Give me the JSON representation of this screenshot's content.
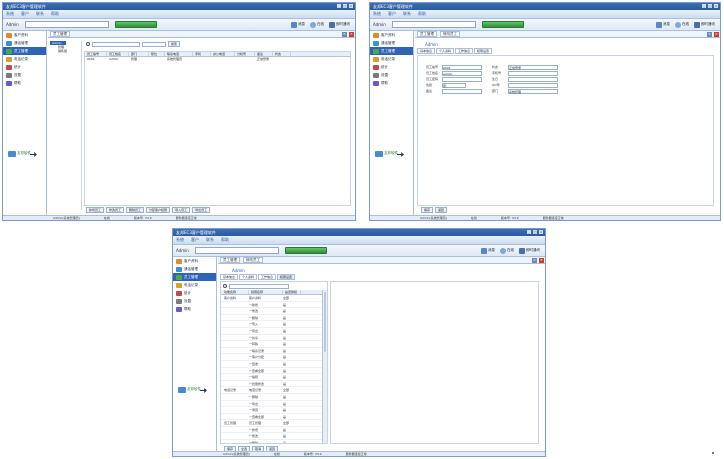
{
  "app": {
    "title": "友邦EC3客户管理软件",
    "menus": [
      "系统",
      "客户",
      "联系",
      "帮助"
    ],
    "user": "Admin",
    "toolbar_buttons": [
      "消息",
      "在线",
      "即时通讯"
    ]
  },
  "sidebar": {
    "items": [
      {
        "label": "客户资料",
        "icon": "customer-icon",
        "color": "#e08a2a"
      },
      {
        "label": "通话管理",
        "icon": "phone-icon",
        "color": "#3c8fd6"
      },
      {
        "label": "员工管理",
        "icon": "staff-icon",
        "color": "#4aa84e"
      },
      {
        "label": "电话记录",
        "icon": "record-icon",
        "color": "#d6a02a"
      },
      {
        "label": "统计",
        "icon": "stats-icon",
        "color": "#c04a4a"
      },
      {
        "label": "设置",
        "icon": "settings-icon",
        "color": "#7a7a7a"
      },
      {
        "label": "帮助",
        "icon": "help-icon",
        "color": "#6a5ac8"
      }
    ],
    "logo_text": "友邦软件"
  },
  "win1": {
    "tab": "员工管理",
    "tree_root": "Admin",
    "tree_children": [
      "管理",
      "销售组"
    ],
    "search_placeholder": "",
    "search_button": "搜索",
    "columns": [
      "员工编号",
      "员工姓名",
      "部门",
      "职位",
      "联系电话",
      "手机",
      "办公电话",
      "分机号",
      "备注",
      "状态"
    ],
    "rows": [
      [
        "0001",
        "admin",
        "管理",
        "",
        "系统管理员",
        "",
        "",
        "",
        "正常登录",
        ""
      ]
    ],
    "bottom_buttons": [
      "新增员工",
      "修改员工",
      "删除员工",
      "分配客户权限",
      "导入员工",
      "导出员工"
    ]
  },
  "win2": {
    "tabs": [
      "员工管理",
      "修改员工"
    ],
    "name_header": "Admin",
    "subtabs": [
      "基本信息",
      "个人资料",
      "工作信息",
      "权限设置"
    ],
    "fields": [
      {
        "label": "员工编号",
        "value": "0001"
      },
      {
        "label": "员工姓名",
        "value": "admin"
      },
      {
        "label": "员工密码",
        "value": ""
      },
      {
        "label": "性别",
        "value": "男"
      },
      {
        "label": "备注",
        "value": ""
      }
    ],
    "right_fields": [
      {
        "label": "状态",
        "value": "正常登录"
      },
      {
        "label": "手机号",
        "value": ""
      },
      {
        "label": "生日",
        "value": ""
      },
      {
        "label": "QQ号",
        "value": ""
      },
      {
        "label": "部门",
        "value": "系统管理"
      }
    ],
    "bottom_buttons": [
      "保存",
      "返回"
    ]
  },
  "win3": {
    "tabs": [
      "员工管理",
      "修改员工"
    ],
    "name_header": "Admin",
    "subtabs": [
      "基本信息",
      "个人资料",
      "工作信息",
      "权限设置"
    ],
    "perm_columns": [
      "功能名称",
      "权限名称",
      "是否授权"
    ],
    "perm_rows": [
      [
        "客户资料",
        "客户资料",
        "全部"
      ],
      [
        "",
        "一新增",
        "是"
      ],
      [
        "",
        "一修改",
        "是"
      ],
      [
        "",
        "一删除",
        "是"
      ],
      [
        "",
        "一导入",
        "是"
      ],
      [
        "",
        "一导出",
        "是"
      ],
      [
        "",
        "一共享",
        "是"
      ],
      [
        "",
        "一转移",
        "是"
      ],
      [
        "",
        "一联系记录",
        "是"
      ],
      [
        "",
        "一客户分配",
        "是"
      ],
      [
        "",
        "一回收",
        "是"
      ],
      [
        "",
        "一查看全部",
        "是"
      ],
      [
        "",
        "一编辑",
        "是"
      ],
      [
        "",
        "一批量修改",
        "是"
      ],
      [
        "电话记录",
        "电话记录",
        "全部"
      ],
      [
        "",
        "一删除",
        "是"
      ],
      [
        "",
        "一导出",
        "是"
      ],
      [
        "",
        "一录音",
        "是"
      ],
      [
        "",
        "一查看全部",
        "是"
      ],
      [
        "员工管理",
        "员工管理",
        "全部"
      ],
      [
        "",
        "一新增",
        "是"
      ],
      [
        "",
        "一修改",
        "是"
      ],
      [
        "",
        "一删除",
        "是"
      ],
      [
        "",
        "一导入",
        "是"
      ],
      [
        "",
        "一导出",
        "是"
      ],
      [
        "",
        "一权限设置",
        "是"
      ]
    ],
    "bottom_buttons": [
      "保存",
      "全选",
      "取消",
      "返回"
    ]
  },
  "status": {
    "left": "Admin(系统管理员)",
    "mid": "在线",
    "version": "版本号: V3.0",
    "server": "服务器连接正常"
  }
}
